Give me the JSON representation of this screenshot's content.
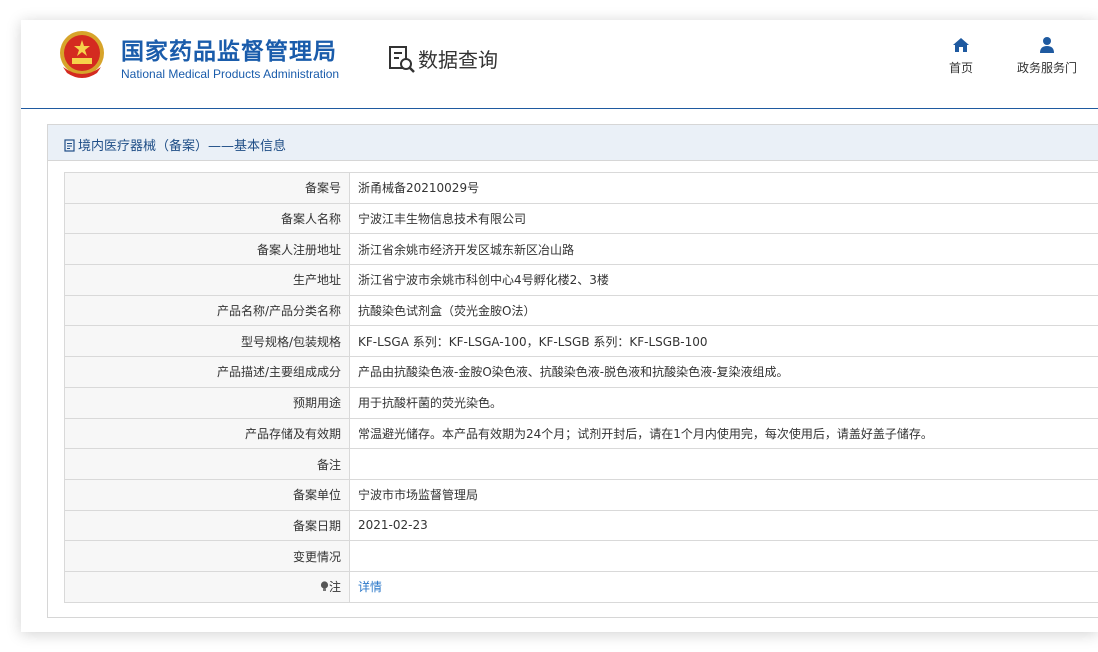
{
  "header": {
    "org_name_cn": "国家药品监督管理局",
    "org_name_en": "National Medical Products Administration",
    "page_title": "数据查询",
    "nav": [
      {
        "label": "首页",
        "icon": "home-icon"
      },
      {
        "label": "政务服务门",
        "icon": "user-icon"
      }
    ]
  },
  "section": {
    "title": "境内医疗器械（备案）——基本信息",
    "icon": "document-icon"
  },
  "rows": [
    {
      "label": "备案号",
      "value": "浙甬械备20210029号"
    },
    {
      "label": "备案人名称",
      "value": "宁波江丰生物信息技术有限公司"
    },
    {
      "label": "备案人注册地址",
      "value": "浙江省余姚市经济开发区城东新区冶山路"
    },
    {
      "label": "生产地址",
      "value": "浙江省宁波市余姚市科创中心4号孵化楼2、3楼"
    },
    {
      "label": "产品名称/产品分类名称",
      "value": "抗酸染色试剂盒（荧光金胺O法）"
    },
    {
      "label": "型号规格/包装规格",
      "value": "KF-LSGA 系列：KF-LSGA-100，KF-LSGB 系列：KF-LSGB-100"
    },
    {
      "label": "产品描述/主要组成成分",
      "value": "产品由抗酸染色液-金胺O染色液、抗酸染色液-脱色液和抗酸染色液-复染液组成。"
    },
    {
      "label": "预期用途",
      "value": "用于抗酸杆菌的荧光染色。"
    },
    {
      "label": "产品存储及有效期",
      "value": "常温避光储存。本产品有效期为24个月；试剂开封后，请在1个月内使用完，每次使用后，请盖好盖子储存。"
    },
    {
      "label": "备注",
      "value": ""
    },
    {
      "label": "备案单位",
      "value": "宁波市市场监督管理局"
    },
    {
      "label": "备案日期",
      "value": "2021-02-23"
    },
    {
      "label": "变更情况",
      "value": ""
    }
  ],
  "note_row": {
    "label": "注",
    "link": "详情",
    "icon": "bulb-icon"
  },
  "colors": {
    "brand_blue": "#1a5cab",
    "link_blue": "#2a77c9",
    "bar_bg": "#eaf0f7"
  }
}
